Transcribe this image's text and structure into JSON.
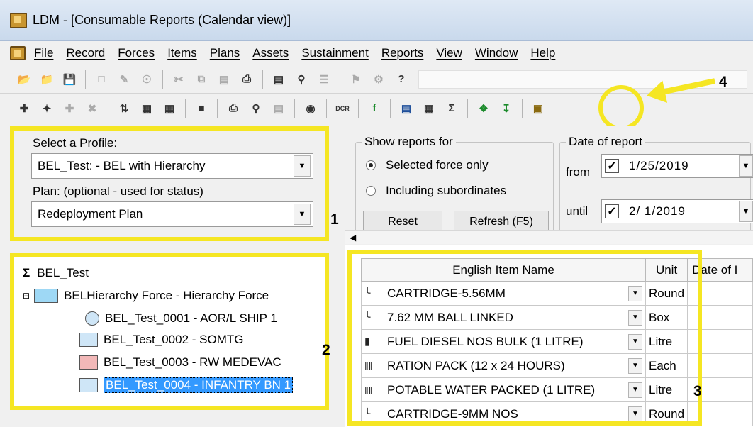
{
  "window": {
    "title": "LDM - [Consumable Reports (Calendar view)]"
  },
  "menu": [
    "File",
    "Record",
    "Forces",
    "Items",
    "Plans",
    "Assets",
    "Sustainment",
    "Reports",
    "View",
    "Window",
    "Help"
  ],
  "profile": {
    "select_label": "Select a Profile:",
    "profile_value": "BEL_Test: - BEL  with Hierarchy",
    "plan_label": "Plan: (optional - used for status)",
    "plan_value": "Redeployment Plan"
  },
  "show_reports": {
    "title": "Show reports for",
    "opt1": "Selected force only",
    "opt2": "Including subordinates",
    "reset": "Reset",
    "refresh": "Refresh (F5)"
  },
  "date_of_report": {
    "title": "Date of report",
    "from_label": "from",
    "from_value": "1/25/2019",
    "until_label": "until",
    "until_value": "2/ 1/2019"
  },
  "tree": {
    "root": "BEL_Test",
    "force": "BELHierarchy Force - Hierarchy Force",
    "units": [
      "BEL_Test_0001 - AOR/L SHIP 1",
      "BEL_Test_0002 - SOMTG",
      "BEL_Test_0003 - RW MEDEVAC",
      "BEL_Test_0004 - INFANTRY BN 1"
    ]
  },
  "grid": {
    "headers": [
      "English Item Name",
      "Unit",
      "Date of I"
    ],
    "rows": [
      {
        "name": "CARTRIDGE-5.56MM",
        "unit": "Round",
        "icon": "cartridge-icon"
      },
      {
        "name": "7.62 MM BALL LINKED",
        "unit": "Box",
        "icon": "cartridge-icon"
      },
      {
        "name": "FUEL DIESEL NOS BULK (1 LITRE)",
        "unit": "Litre",
        "icon": "fuel-icon"
      },
      {
        "name": "RATION PACK (12 x 24 HOURS)",
        "unit": "Each",
        "icon": "ration-icon"
      },
      {
        "name": "POTABLE WATER PACKED (1 LITRE)",
        "unit": "Litre",
        "icon": "ration-icon"
      },
      {
        "name": "CARTRIDGE-9MM NOS",
        "unit": "Round",
        "icon": "cartridge-icon"
      }
    ]
  },
  "callouts": {
    "c1": "1",
    "c2": "2",
    "c3": "3",
    "c4": "4"
  },
  "colors": {
    "highlight": "#f5e623",
    "selection": "#3399ff"
  }
}
